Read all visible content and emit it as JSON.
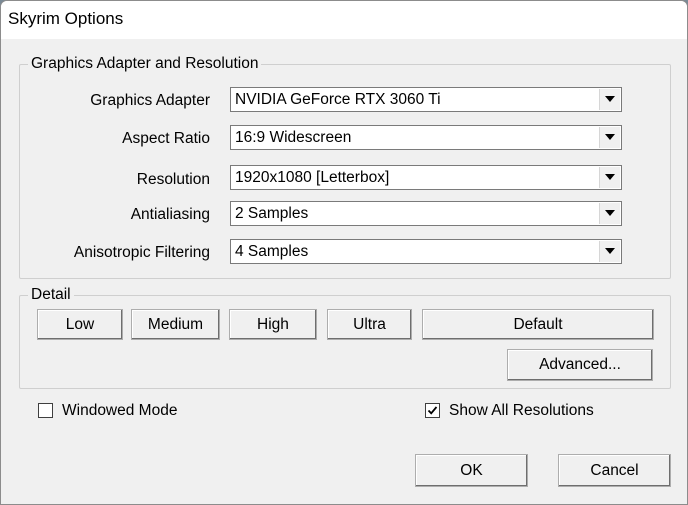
{
  "window": {
    "title": "Skyrim Options"
  },
  "graphics_group": {
    "legend": "Graphics Adapter and Resolution",
    "rows": [
      {
        "label": "Graphics Adapter",
        "value": "NVIDIA GeForce RTX 3060 Ti"
      },
      {
        "label": "Aspect Ratio",
        "value": "16:9 Widescreen"
      },
      {
        "label": "Resolution",
        "value": "1920x1080 [Letterbox]"
      },
      {
        "label": "Antialiasing",
        "value": "2 Samples"
      },
      {
        "label": "Anisotropic Filtering",
        "value": "4 Samples"
      }
    ],
    "dropdown_icon": "chevron-down-icon"
  },
  "detail_group": {
    "legend": "Detail",
    "buttons": {
      "low": "Low",
      "medium": "Medium",
      "high": "High",
      "ultra": "Ultra",
      "default": "Default",
      "advanced": "Advanced..."
    }
  },
  "options": {
    "windowed_mode": {
      "label": "Windowed Mode",
      "checked": false
    },
    "show_all_resolutions": {
      "label": "Show All Resolutions",
      "checked": true
    }
  },
  "dialog_buttons": {
    "ok": "OK",
    "cancel": "Cancel"
  },
  "colors": {
    "window_bg": "#f0f0f0",
    "titlebar_bg": "#ffffff",
    "group_border": "#cfcfcf",
    "button_border": "#adadad"
  }
}
